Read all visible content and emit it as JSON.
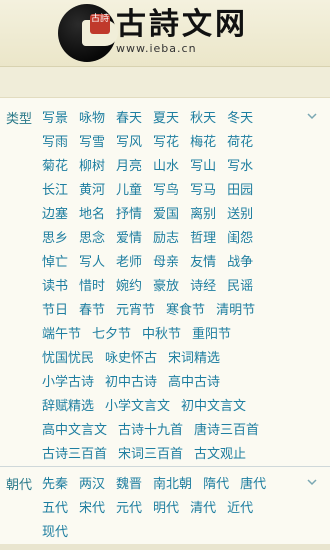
{
  "header": {
    "seal_text": "古詩",
    "title": "古詩文网",
    "url": "www.ieba.cn"
  },
  "categories": {
    "label": "类型",
    "rows": [
      [
        "写景",
        "咏物",
        "春天",
        "夏天",
        "秋天",
        "冬天"
      ],
      [
        "写雨",
        "写雪",
        "写风",
        "写花",
        "梅花",
        "荷花"
      ],
      [
        "菊花",
        "柳树",
        "月亮",
        "山水",
        "写山",
        "写水"
      ],
      [
        "长江",
        "黄河",
        "儿童",
        "写鸟",
        "写马",
        "田园"
      ],
      [
        "边塞",
        "地名",
        "抒情",
        "爱国",
        "离别",
        "送别"
      ],
      [
        "思乡",
        "思念",
        "爱情",
        "励志",
        "哲理",
        "闺怨"
      ],
      [
        "悼亡",
        "写人",
        "老师",
        "母亲",
        "友情",
        "战争"
      ],
      [
        "读书",
        "惜时",
        "婉约",
        "豪放",
        "诗经",
        "民谣"
      ],
      [
        "节日",
        "春节",
        "元宵节",
        "寒食节",
        "清明节"
      ],
      [
        "端午节",
        "七夕节",
        "中秋节",
        "重阳节"
      ],
      [
        "忧国忧民",
        "咏史怀古",
        "宋词精选"
      ],
      [
        "小学古诗",
        "初中古诗",
        "高中古诗"
      ],
      [
        "辞赋精选",
        "小学文言文",
        "初中文言文"
      ],
      [
        "高中文言文",
        "古诗十九首",
        "唐诗三百首"
      ],
      [
        "古诗三百首",
        "宋词三百首",
        "古文观止"
      ]
    ]
  },
  "dynasties": {
    "label": "朝代",
    "rows": [
      [
        "先秦",
        "两汉",
        "魏晋",
        "南北朝",
        "隋代",
        "唐代"
      ],
      [
        "五代",
        "宋代",
        "元代",
        "明代",
        "清代",
        "近代"
      ],
      [
        "现代"
      ]
    ]
  },
  "icons": {
    "logo": "c-logo",
    "expand": "chevron-down-icon"
  },
  "colors": {
    "link": "#1e7ea0",
    "label": "#2b7a8a",
    "background": "#fbfaf2"
  }
}
